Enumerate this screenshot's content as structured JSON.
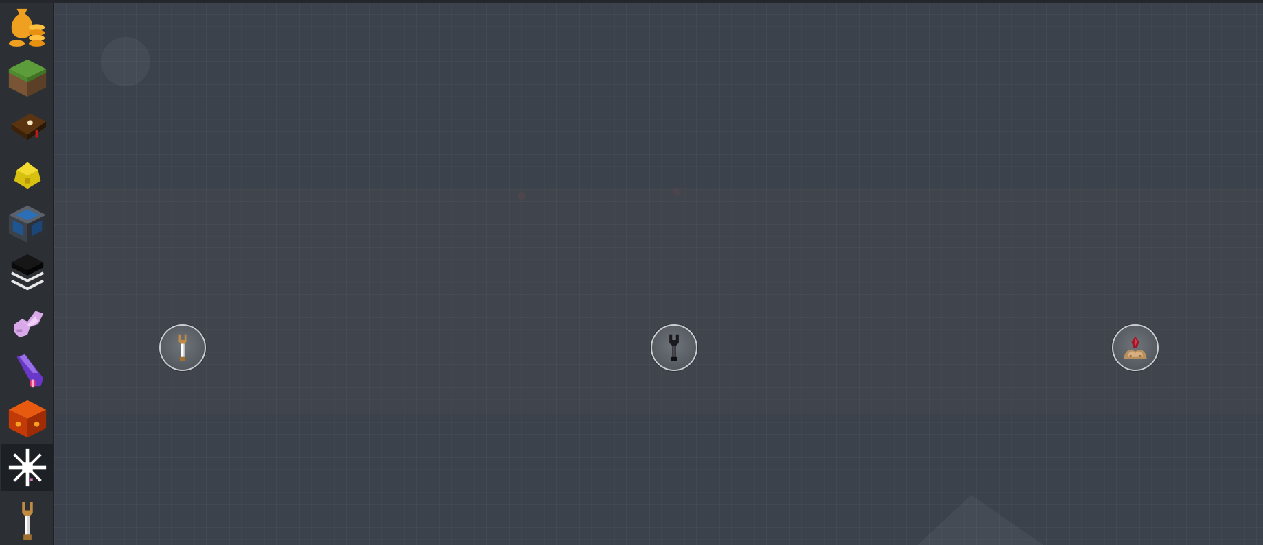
{
  "sidebar": {
    "tabs": [
      {
        "icon": "coin-bag-icon",
        "selected": false
      },
      {
        "icon": "grass-block-icon",
        "selected": false
      },
      {
        "icon": "enchanted-book-icon",
        "selected": false
      },
      {
        "icon": "glowstone-dust-icon",
        "selected": false
      },
      {
        "icon": "machine-block-icon",
        "selected": false
      },
      {
        "icon": "layered-cube-icon",
        "selected": false
      },
      {
        "icon": "pink-crystal-icon",
        "selected": false
      },
      {
        "icon": "purple-wand-icon",
        "selected": false
      },
      {
        "icon": "lava-block-icon",
        "selected": false
      },
      {
        "icon": "white-starburst-icon",
        "selected": true
      },
      {
        "icon": "bronze-tool-icon",
        "selected": false
      }
    ]
  },
  "nodes": [
    {
      "icon": "bronze-tool-icon"
    },
    {
      "icon": "dark-tool-icon"
    },
    {
      "icon": "ore-pile-icon"
    }
  ],
  "colors": {
    "background": "#3c424b",
    "sidebar": "#2c3035",
    "node_border": "#c9ccd0",
    "coin_gold": "#f0a020"
  }
}
